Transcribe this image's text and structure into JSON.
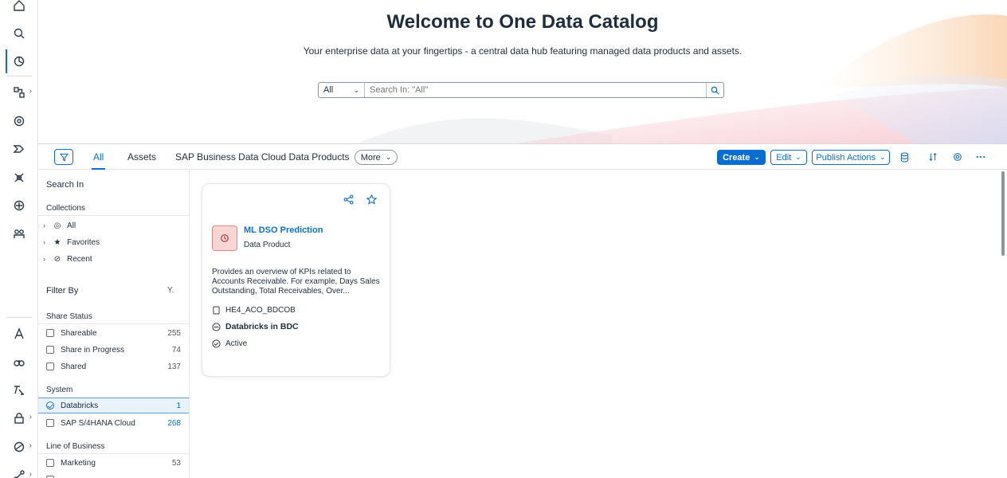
{
  "hero": {
    "title": "Welcome to One Data Catalog",
    "subtitle": "Your enterprise data at your fingertips - a central data hub featuring managed data products and assets."
  },
  "search": {
    "scope": "All",
    "placeholder": "Search In: \"All\""
  },
  "tabs": [
    "All",
    "Assets",
    "SAP Business Data Cloud Data Products"
  ],
  "toolbar": {
    "more": "More",
    "create": "Create",
    "edit": "Edit",
    "publish_actions": "Publish Actions"
  },
  "panel": {
    "search_in": "Search In",
    "collections_label": "Collections",
    "collections": [
      "All",
      "Favorites",
      "Recent"
    ],
    "filter_by": "Filter By",
    "share_status_label": "Share Status",
    "share_status": [
      {
        "label": "Shareable",
        "count": "255"
      },
      {
        "label": "Share in Progress",
        "count": "74"
      },
      {
        "label": "Shared",
        "count": "137"
      }
    ],
    "system_label": "System",
    "system": [
      {
        "label": "Databricks",
        "count": "1"
      },
      {
        "label": "SAP S/4HANA Cloud",
        "count": "268"
      }
    ],
    "lob_label": "Line of Business",
    "lob": [
      {
        "label": "Marketing",
        "count": "53"
      }
    ]
  },
  "card": {
    "title": "ML DSO Prediction",
    "type": "Data Product",
    "description": "Provides an overview of KPIs related to Accounts Receivable. For example, Days Sales Outstanding, Total Receivables, Over...",
    "id": "HE4_ACO_BDCOB",
    "system": "Databricks in BDC",
    "status": "Active"
  },
  "colors": {
    "accent": "#0a6ed1",
    "thumb_bg": "#f9d6d3"
  }
}
